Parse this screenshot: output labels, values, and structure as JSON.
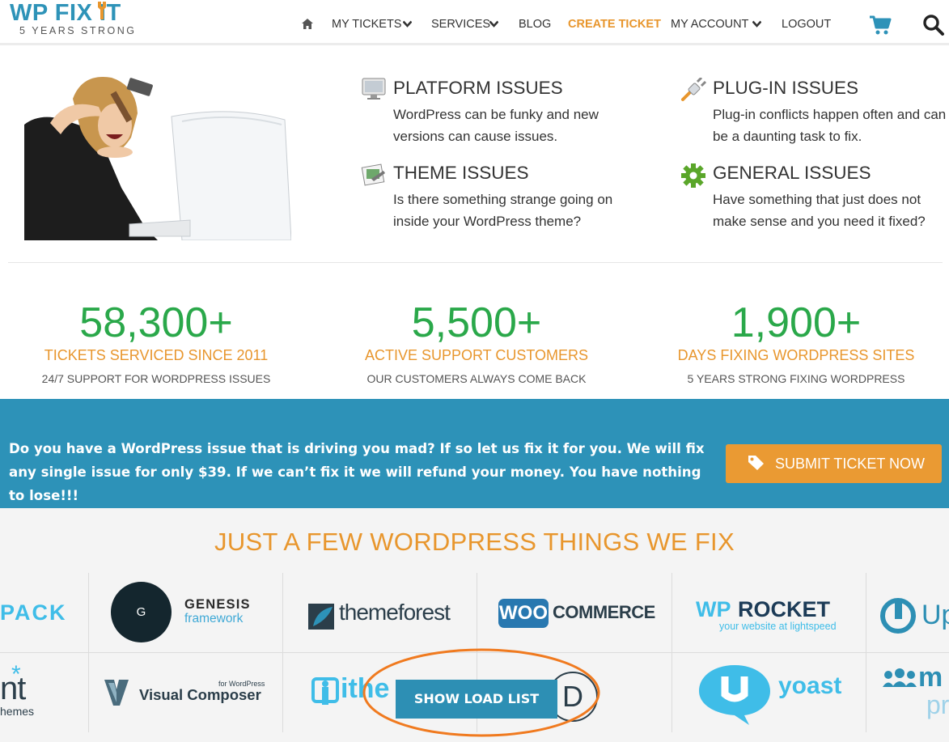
{
  "brand": {
    "name": "WP FIX IT",
    "tagline": "5 YEARS STRONG"
  },
  "nav": {
    "home_icon": "home-icon",
    "items": [
      {
        "label": "MY TICKETS",
        "has_dropdown": true
      },
      {
        "label": "SERVICES",
        "has_dropdown": true
      },
      {
        "label": "BLOG",
        "has_dropdown": false
      },
      {
        "label": "CREATE TICKET",
        "has_dropdown": false,
        "active": true
      },
      {
        "label": "MY ACCOUNT",
        "has_dropdown": true
      },
      {
        "label": "LOGOUT",
        "has_dropdown": false
      }
    ],
    "cart_icon": "cart-icon",
    "search_icon": "search-icon"
  },
  "issues": [
    {
      "title": "PLATFORM ISSUES",
      "desc": "WordPress can be funky and new versions can cause issues.",
      "icon": "monitor-icon"
    },
    {
      "title": "PLUG-IN ISSUES",
      "desc": "Plug-in conflicts happen often and can be a daunting task to fix.",
      "icon": "plug-icon"
    },
    {
      "title": "THEME ISSUES",
      "desc": "Is there something strange going on inside your WordPress theme?",
      "icon": "theme-icon"
    },
    {
      "title": "GENERAL ISSUES",
      "desc": "Have something that just does not make sense and you need it fixed?",
      "icon": "gear-icon"
    }
  ],
  "stats": [
    {
      "number": "58,300+",
      "label": "TICKETS SERVICED SINCE 2011",
      "sub": "24/7 SUPPORT FOR WORDPRESS ISSUES"
    },
    {
      "number": "5,500+",
      "label": "ACTIVE SUPPORT CUSTOMERS",
      "sub": "OUR CUSTOMERS ALWAYS COME BACK"
    },
    {
      "number": "1,900+",
      "label": "DAYS FIXING WORDPRESS SITES",
      "sub": "5 YEARS STRONG FIXING WORDPRESS"
    }
  ],
  "band": {
    "message": "Do you have a WordPress issue that is driving you mad? If so let us fix it for you. We will fix any single issue for only $39. If we can’t fix it we will refund your money. You have nothing to lose!!!",
    "cta_label": "SUBMIT TICKET NOW",
    "cta_icon": "tag-icon"
  },
  "logos": {
    "title": "JUST A FEW WORDPRESS THINGS WE FIX",
    "row1": {
      "jetpack": "PACK",
      "genesis_mark": "G",
      "genesis_name": "GENESIS",
      "genesis_sub": "framework",
      "themeforest": "themeforest",
      "woo": "WOO",
      "commerce": "COMMERCE",
      "wprocket_wp": "WP",
      "wprocket_rocket": "ROCKET",
      "wprocket_sub": "your website at lightspeed",
      "updraft": "Up"
    },
    "row2": {
      "elegant_star": "*",
      "elegant_main": "nt",
      "elegant_sub": "hemes",
      "vc_small": "for WordPress",
      "vc_name": "Visual Composer",
      "ithemes": "ithe",
      "divi": "D",
      "yoast": "yoast",
      "memberpress_top": "m",
      "memberpress_sub": "pr"
    }
  },
  "load_button": "SHOW LOAD LIST",
  "colors": {
    "accent_orange": "#e8962d",
    "brand_blue": "#2d92b8",
    "stat_green": "#2aa84a"
  }
}
